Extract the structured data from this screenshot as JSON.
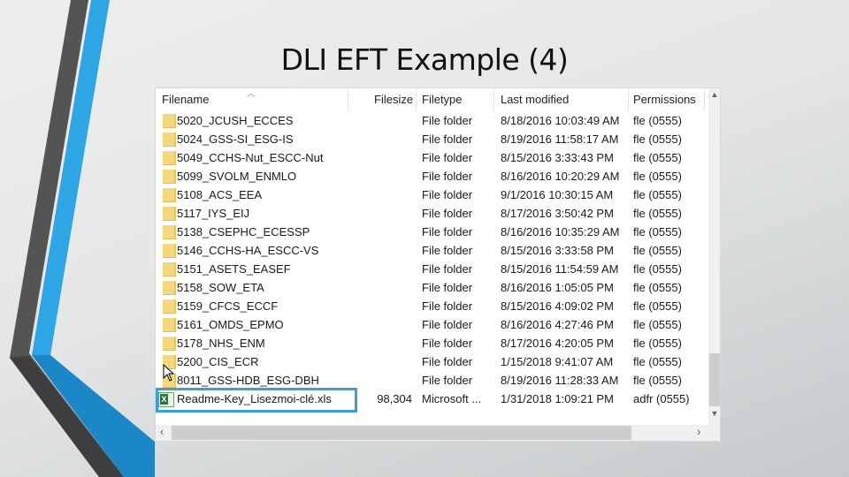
{
  "slide": {
    "title": "DLI EFT Example (4)",
    "accent_colors": {
      "blue": "#2ea6e6",
      "dark": "#555555",
      "selection": "#3aa0d8"
    }
  },
  "explorer": {
    "columns": {
      "filename": "Filename",
      "filesize": "Filesize",
      "filetype": "Filetype",
      "last_modified": "Last modified",
      "permissions": "Permissions"
    },
    "sort_indicator": "sort-ascending-icon",
    "rows": [
      {
        "icon": "folder-icon",
        "name": "5020_JCUSH_ECCES",
        "size": "",
        "type": "File folder",
        "modified": "8/18/2016 10:03:49 AM",
        "permissions": "fle (0555)"
      },
      {
        "icon": "folder-icon",
        "name": "5024_GSS-SI_ESG-IS",
        "size": "",
        "type": "File folder",
        "modified": "8/19/2016 11:58:17 AM",
        "permissions": "fle (0555)"
      },
      {
        "icon": "folder-icon",
        "name": "5049_CCHS-Nut_ESCC-Nut",
        "size": "",
        "type": "File folder",
        "modified": "8/15/2016 3:33:43 PM",
        "permissions": "fle (0555)"
      },
      {
        "icon": "folder-icon",
        "name": "5099_SVOLM_ENMLO",
        "size": "",
        "type": "File folder",
        "modified": "8/16/2016 10:20:29 AM",
        "permissions": "fle (0555)"
      },
      {
        "icon": "folder-icon",
        "name": "5108_ACS_EEA",
        "size": "",
        "type": "File folder",
        "modified": "9/1/2016 10:30:15 AM",
        "permissions": "fle (0555)"
      },
      {
        "icon": "folder-icon",
        "name": "5117_IYS_EIJ",
        "size": "",
        "type": "File folder",
        "modified": "8/17/2016 3:50:42 PM",
        "permissions": "fle (0555)"
      },
      {
        "icon": "folder-icon",
        "name": "5138_CSEPHC_ECESSP",
        "size": "",
        "type": "File folder",
        "modified": "8/16/2016 10:35:29 AM",
        "permissions": "fle (0555)"
      },
      {
        "icon": "folder-icon",
        "name": "5146_CCHS-HA_ESCC-VS",
        "size": "",
        "type": "File folder",
        "modified": "8/15/2016 3:33:58 PM",
        "permissions": "fle (0555)"
      },
      {
        "icon": "folder-icon",
        "name": "5151_ASETS_EASEF",
        "size": "",
        "type": "File folder",
        "modified": "8/15/2016 11:54:59 AM",
        "permissions": "fle (0555)"
      },
      {
        "icon": "folder-icon",
        "name": "5158_SOW_ETA",
        "size": "",
        "type": "File folder",
        "modified": "8/16/2016 1:05:05 PM",
        "permissions": "fle (0555)"
      },
      {
        "icon": "folder-icon",
        "name": "5159_CFCS_ECCF",
        "size": "",
        "type": "File folder",
        "modified": "8/15/2016 4:09:02 PM",
        "permissions": "fle (0555)"
      },
      {
        "icon": "folder-icon",
        "name": "5161_OMDS_EPMO",
        "size": "",
        "type": "File folder",
        "modified": "8/16/2016 4:27:46 PM",
        "permissions": "fle (0555)"
      },
      {
        "icon": "folder-icon",
        "name": "5178_NHS_ENM",
        "size": "",
        "type": "File folder",
        "modified": "8/17/2016 4:20:05 PM",
        "permissions": "fle (0555)"
      },
      {
        "icon": "folder-icon",
        "name": "5200_CIS_ECR",
        "size": "",
        "type": "File folder",
        "modified": "1/15/2018 9:41:07 AM",
        "permissions": "fle (0555)"
      },
      {
        "icon": "folder-icon",
        "name": "8011_GSS-HDB_ESG-DBH",
        "size": "",
        "type": "File folder",
        "modified": "8/19/2016 11:28:33 AM",
        "permissions": "fle (0555)"
      },
      {
        "icon": "excel-file-icon",
        "name": "Readme-Key_Lisezmoi-clé.xls",
        "size": "98,304",
        "type": "Microsoft ...",
        "modified": "1/31/2018 1:09:21 PM",
        "permissions": "adfr (0555)",
        "highlighted": true
      }
    ]
  }
}
